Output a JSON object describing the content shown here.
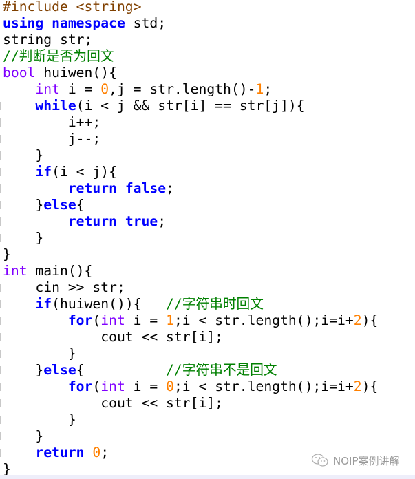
{
  "colors": {
    "keyword": "#0000ff",
    "type": "#8000ff",
    "number": "#ff8000",
    "comment": "#008000",
    "preprocessor": "#804000"
  },
  "code_lines": [
    [
      [
        "pp",
        "#include <string>"
      ]
    ],
    [
      [
        "kw",
        "using"
      ],
      [
        "t",
        " "
      ],
      [
        "kw",
        "namespace"
      ],
      [
        "t",
        " std;"
      ]
    ],
    [
      [
        "t",
        "string str;"
      ]
    ],
    [
      [
        "cm",
        "//判断是否为回文"
      ]
    ],
    [
      [
        "ty",
        "bool"
      ],
      [
        "t",
        " huiwen(){"
      ]
    ],
    [
      [
        "t",
        "    "
      ],
      [
        "ty",
        "int"
      ],
      [
        "t",
        " i = "
      ],
      [
        "num",
        "0"
      ],
      [
        "t",
        ",j = str.length()-"
      ],
      [
        "num",
        "1"
      ],
      [
        "t",
        ";"
      ]
    ],
    [
      [
        "t",
        "    "
      ],
      [
        "kw",
        "while"
      ],
      [
        "t",
        "(i < j && str[i] == str[j]){"
      ]
    ],
    [
      [
        "t",
        "        i++;"
      ]
    ],
    [
      [
        "t",
        "        j--;"
      ]
    ],
    [
      [
        "t",
        "    }"
      ]
    ],
    [
      [
        "t",
        "    "
      ],
      [
        "kw",
        "if"
      ],
      [
        "t",
        "(i < j){"
      ]
    ],
    [
      [
        "t",
        "        "
      ],
      [
        "kw",
        "return"
      ],
      [
        "t",
        " "
      ],
      [
        "kw",
        "false"
      ],
      [
        "t",
        ";"
      ]
    ],
    [
      [
        "t",
        "    }"
      ],
      [
        "kw",
        "else"
      ],
      [
        "t",
        "{"
      ]
    ],
    [
      [
        "t",
        "        "
      ],
      [
        "kw",
        "return"
      ],
      [
        "t",
        " "
      ],
      [
        "kw",
        "true"
      ],
      [
        "t",
        ";"
      ]
    ],
    [
      [
        "t",
        "    }"
      ]
    ],
    [
      [
        "t",
        "}"
      ]
    ],
    [
      [
        "ty",
        "int"
      ],
      [
        "t",
        " main(){"
      ]
    ],
    [
      [
        "t",
        "    cin >> str;"
      ]
    ],
    [
      [
        "t",
        "    "
      ],
      [
        "kw",
        "if"
      ],
      [
        "t",
        "(huiwen()){   "
      ],
      [
        "cm",
        "//字符串时回文"
      ]
    ],
    [
      [
        "t",
        "        "
      ],
      [
        "kw",
        "for"
      ],
      [
        "t",
        "("
      ],
      [
        "ty",
        "int"
      ],
      [
        "t",
        " i = "
      ],
      [
        "num",
        "1"
      ],
      [
        "t",
        ";i < str.length();i=i+"
      ],
      [
        "num",
        "2"
      ],
      [
        "t",
        "){"
      ]
    ],
    [
      [
        "t",
        "            cout << str[i];"
      ]
    ],
    [
      [
        "t",
        "        }"
      ]
    ],
    [
      [
        "t",
        "    }"
      ],
      [
        "kw",
        "else"
      ],
      [
        "t",
        "{          "
      ],
      [
        "cm",
        "//字符串不是回文"
      ]
    ],
    [
      [
        "t",
        "        "
      ],
      [
        "kw",
        "for"
      ],
      [
        "t",
        "("
      ],
      [
        "ty",
        "int"
      ],
      [
        "t",
        " i = "
      ],
      [
        "num",
        "0"
      ],
      [
        "t",
        ";i < str.length();i=i+"
      ],
      [
        "num",
        "2"
      ],
      [
        "t",
        "){"
      ]
    ],
    [
      [
        "t",
        "            cout << str[i];"
      ]
    ],
    [
      [
        "t",
        "        }"
      ]
    ],
    [
      [
        "t",
        "    }"
      ]
    ],
    [
      [
        "t",
        "    "
      ],
      [
        "kw",
        "return"
      ],
      [
        "t",
        " "
      ],
      [
        "num",
        "0"
      ],
      [
        "t",
        ";"
      ]
    ],
    [
      [
        "t",
        "}"
      ]
    ]
  ],
  "fold_marker_lines": [
    6,
    7,
    8,
    9,
    10,
    11,
    12,
    13,
    14,
    17,
    18,
    19,
    20,
    21,
    22,
    23,
    24,
    25,
    26,
    27
  ],
  "watermark": {
    "icon": "wechat-icon",
    "text": "NOIP案例讲解"
  }
}
